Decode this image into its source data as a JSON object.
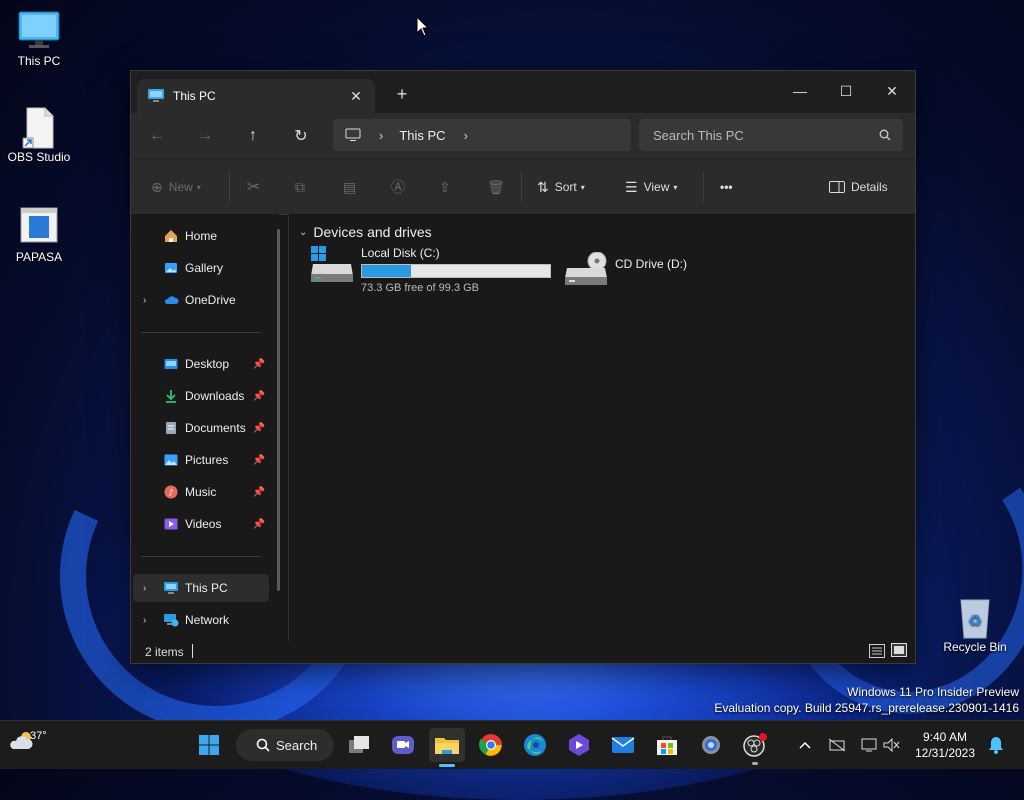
{
  "desktop": {
    "icons": [
      {
        "label": "This PC",
        "icon": "monitor-icon"
      },
      {
        "label": "OBS Studio",
        "icon": "file-shortcut-icon"
      },
      {
        "label": "PAPASA",
        "icon": "app-window-icon"
      },
      {
        "label": "Recycle Bin",
        "icon": "recycle-bin-icon"
      }
    ],
    "watermark": {
      "line1": "Windows 11 Pro Insider Preview",
      "line2": "Evaluation copy. Build 25947.rs_prerelease.230901-1416"
    }
  },
  "explorer": {
    "tab": {
      "title": "This PC",
      "close_glyph": "✕"
    },
    "new_tab_glyph": "+",
    "window_controls": {
      "minimize": "—",
      "maximize": "☐",
      "close": "✕"
    },
    "address": {
      "root_icon": "computer-icon",
      "path": [
        "This PC"
      ]
    },
    "search": {
      "placeholder": "Search This PC"
    },
    "toolbar": {
      "new_label": "New",
      "sort_label": "Sort",
      "view_label": "View",
      "more_glyph": "•••",
      "details_label": "Details"
    },
    "sidebar": {
      "top": [
        {
          "label": "Home",
          "icon": "home-icon",
          "color": "#e8a35a",
          "expandable": false
        },
        {
          "label": "Gallery",
          "icon": "gallery-icon",
          "color": "#3aa0ff",
          "expandable": false
        },
        {
          "label": "OneDrive",
          "icon": "cloud-icon",
          "color": "#2b8be8",
          "expandable": true
        }
      ],
      "pinned": [
        {
          "label": "Desktop",
          "icon": "desktop-folder-icon",
          "color": "#2b8be8"
        },
        {
          "label": "Downloads",
          "icon": "download-icon",
          "color": "#2fbf71"
        },
        {
          "label": "Documents",
          "icon": "documents-icon",
          "color": "#9aa7b8"
        },
        {
          "label": "Pictures",
          "icon": "pictures-icon",
          "color": "#3aa0ff"
        },
        {
          "label": "Music",
          "icon": "music-icon",
          "color": "#e86b5a"
        },
        {
          "label": "Videos",
          "icon": "videos-icon",
          "color": "#8b5ce8"
        }
      ],
      "bottom": [
        {
          "label": "This PC",
          "icon": "computer-icon",
          "color": "#2b9be8",
          "selected": true
        },
        {
          "label": "Network",
          "icon": "network-icon",
          "color": "#2b9be8",
          "selected": false
        }
      ]
    },
    "content": {
      "group_title": "Devices and drives",
      "drives": [
        {
          "name": "Local Disk (C:)",
          "free_text": "73.3 GB free of 99.3 GB",
          "used_fraction": 0.262,
          "icon": "windows-drive-icon"
        },
        {
          "name": "CD Drive (D:)",
          "icon": "cd-drive-icon"
        }
      ]
    },
    "status": {
      "items_text": "2 items"
    }
  },
  "taskbar": {
    "weather": {
      "temp": "37°",
      "icon": "weather-cloud-icon"
    },
    "search_label": "Search",
    "apps": [
      {
        "name": "file-explorer",
        "active": true
      },
      {
        "name": "chrome"
      },
      {
        "name": "edge"
      }
    ],
    "clock": {
      "time": "9:40 AM",
      "date": "12/31/2023"
    }
  },
  "colors": {
    "accent": "#2a9be0",
    "window_bg": "#191919",
    "bar_bg": "#2b2b2b"
  }
}
